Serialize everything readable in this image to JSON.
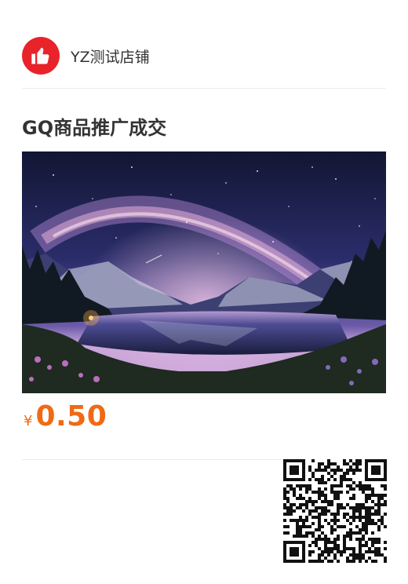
{
  "shop": {
    "name": "YZ测试店铺",
    "logo_icon": "thumbs-up-icon",
    "logo_color": "#e8232a"
  },
  "product": {
    "title": "GQ商品推广成交",
    "image_subject": "milky-way-mountain-lake-image",
    "price_currency": "¥",
    "price_value": "0.50",
    "price_color": "#f06a14"
  },
  "qr": {
    "icon": "qr-code-icon"
  }
}
